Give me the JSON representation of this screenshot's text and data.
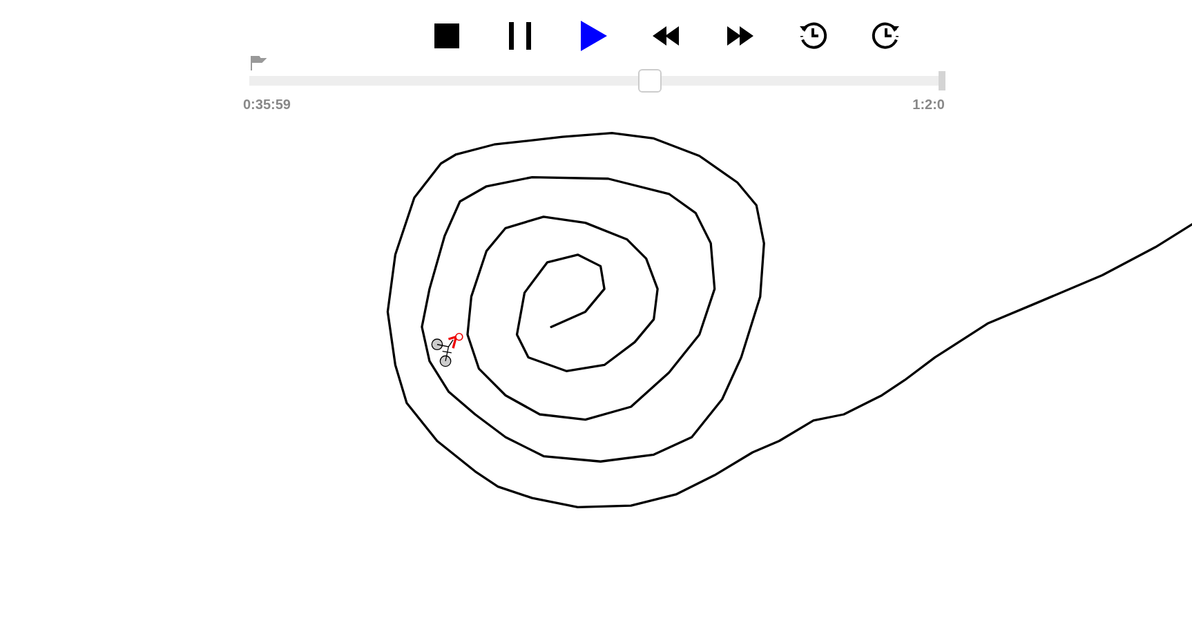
{
  "controls": [
    {
      "kind": "stop",
      "selected": false
    },
    {
      "kind": "pause",
      "selected": false
    },
    {
      "kind": "play",
      "selected": true
    },
    {
      "kind": "rewind",
      "selected": false
    },
    {
      "kind": "fast_forward",
      "selected": false
    },
    {
      "kind": "step_back",
      "selected": false
    },
    {
      "kind": "step_forward",
      "selected": false
    }
  ],
  "timeline": {
    "level": 0.578,
    "current_time": "0:35:59",
    "end_time": "1:2:0"
  }
}
